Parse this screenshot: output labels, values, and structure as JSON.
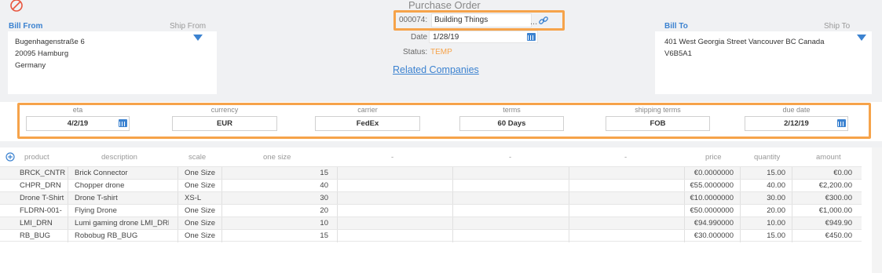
{
  "header": {
    "title": "Purchase Order"
  },
  "bill_from": {
    "label": "Bill From",
    "ship_label": "Ship From",
    "address_lines": [
      "Bugenhagenstraße 6",
      "20095 Hamburg",
      "Germany"
    ]
  },
  "bill_to": {
    "label": "Bill To",
    "ship_label": "Ship To",
    "address_lines": [
      "401 West Georgia Street Vancouver BC Canada",
      "V6B5A1"
    ]
  },
  "po": {
    "number": "000074:",
    "company": "Building Things",
    "dots": "...",
    "date_label": "Date",
    "date": "1/28/19",
    "status_label": "Status:",
    "status": "TEMP",
    "related_link": "Related Companies"
  },
  "terms": {
    "eta_label": "eta",
    "eta": "4/2/19",
    "currency_label": "currency",
    "currency": "EUR",
    "carrier_label": "carrier",
    "carrier": "FedEx",
    "terms_label": "terms",
    "terms": "60 Days",
    "shipping_terms_label": "shipping terms",
    "shipping_terms": "FOB",
    "due_date_label": "due date",
    "due_date": "2/12/19"
  },
  "table": {
    "headers": {
      "product": "product",
      "description": "description",
      "scale": "scale",
      "one_size": "one size",
      "dash1": "-",
      "dash2": "-",
      "dash3": "-",
      "price": "price",
      "quantity": "quantity",
      "amount": "amount"
    },
    "rows": [
      {
        "product": "BRCK_CNTR",
        "description": "Brick Connector",
        "scale": "One Size",
        "qty_size": "15",
        "price": "€0.0000000",
        "quantity": "15.00",
        "amount": "€0.00"
      },
      {
        "product": "CHPR_DRN",
        "description": "Chopper drone",
        "scale": "One Size",
        "qty_size": "40",
        "price": "€55.0000000",
        "quantity": "40.00",
        "amount": "€2,200.00"
      },
      {
        "product": "Drone T-Shirt",
        "description": "Drone T-shirt",
        "scale": "XS-L",
        "qty_size": "30",
        "price": "€10.0000000",
        "quantity": "30.00",
        "amount": "€300.00"
      },
      {
        "product": "FLDRN-001-",
        "description": "Flying Drone",
        "scale": "One Size",
        "qty_size": "20",
        "price": "€50.0000000",
        "quantity": "20.00",
        "amount": "€1,000.00"
      },
      {
        "product": "LMI_DRN",
        "description": "Lumi gaming drone LMI_DRN",
        "scale": "One Size",
        "qty_size": "10",
        "price": "€94.990000",
        "quantity": "10.00",
        "amount": "€949.90"
      },
      {
        "product": "RB_BUG",
        "description": "Robobug RB_BUG",
        "scale": "One Size",
        "qty_size": "15",
        "price": "€30.000000",
        "quantity": "15.00",
        "amount": "€450.00"
      }
    ]
  },
  "colors": {
    "accent": "#3b82d0",
    "highlight": "#f6a34a",
    "status": "#f6a34a"
  }
}
